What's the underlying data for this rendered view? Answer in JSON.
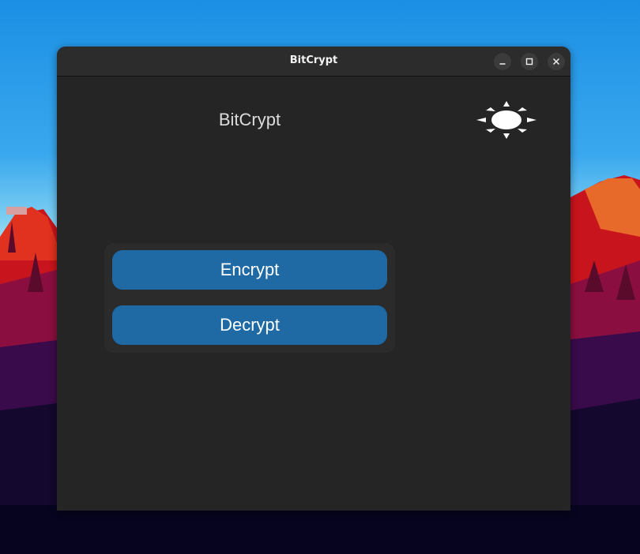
{
  "window": {
    "title": "BitCrypt",
    "controls": {
      "minimize_icon": "minimize-icon",
      "maximize_icon": "maximize-icon",
      "close_icon": "close-icon"
    }
  },
  "app": {
    "heading": "BitCrypt",
    "theme_toggle_icon": "sun-icon",
    "actions": {
      "encrypt_label": "Encrypt",
      "decrypt_label": "Decrypt"
    }
  },
  "colors": {
    "window_bg": "#252525",
    "titlebar_bg": "#2c2c2c",
    "button_accent": "#1f6aa5",
    "panel_bg": "#2b2b2b"
  }
}
